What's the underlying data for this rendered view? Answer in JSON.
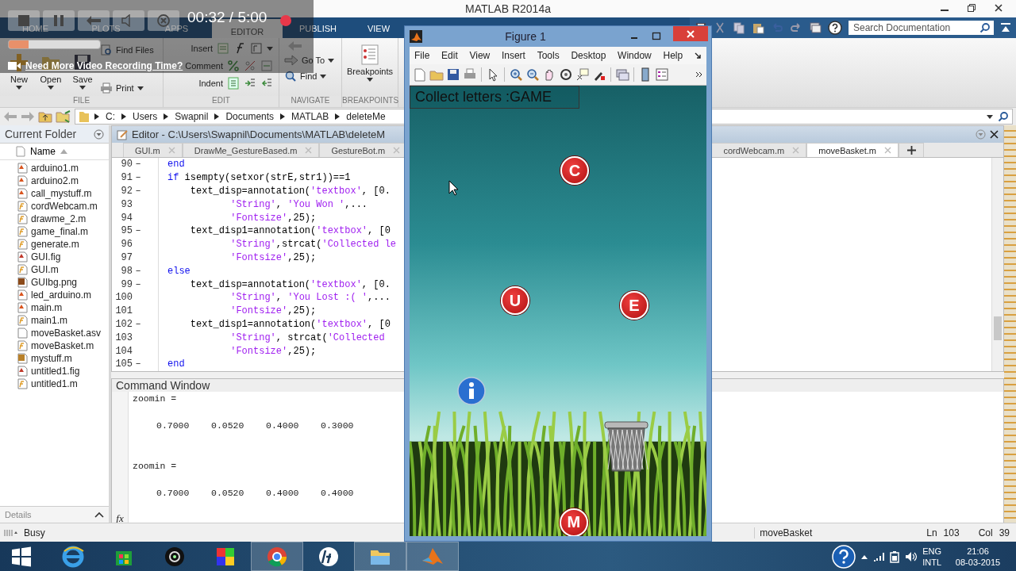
{
  "window": {
    "title": "MATLAB R2014a"
  },
  "recorder": {
    "time": "00:32 / 5:00",
    "level": 0.22,
    "link": "Need More Video Recording Time?"
  },
  "ribbon": {
    "tabs": [
      {
        "label": "HOME",
        "selected": false
      },
      {
        "label": "PLOTS",
        "selected": false
      },
      {
        "label": "APPS",
        "selected": false
      },
      {
        "label": "EDITOR",
        "selected": true
      },
      {
        "label": "PUBLISH",
        "selected": false
      },
      {
        "label": "VIEW",
        "selected": false
      }
    ],
    "file": {
      "label": "FILE",
      "new": "New",
      "open": "Open",
      "save": "Save",
      "find_files": "Find Files",
      "print": "Print"
    },
    "edit": {
      "label": "EDIT",
      "insert": "Insert",
      "comment": "Comment",
      "indent": "Indent"
    },
    "navigate": {
      "label": "NAVIGATE",
      "go_to": "Go To",
      "find": "Find"
    },
    "breakpoints": {
      "label": "BREAKPOINTS",
      "button": "Breakpoints"
    }
  },
  "search": {
    "placeholder": "Search Documentation"
  },
  "address_bar": {
    "path": [
      "C:",
      "Users",
      "Swapnil",
      "Documents",
      "MATLAB",
      "deleteMe"
    ]
  },
  "current_folder": {
    "title": "Current Folder",
    "column": "Name",
    "details": "Details",
    "files": [
      {
        "name": "arduino1.m",
        "kind": "script"
      },
      {
        "name": "arduino2.m",
        "kind": "script"
      },
      {
        "name": "call_mystuff.m",
        "kind": "script"
      },
      {
        "name": "cordWebcam.m",
        "kind": "function"
      },
      {
        "name": "drawme_2.m",
        "kind": "function"
      },
      {
        "name": "game_final.m",
        "kind": "function"
      },
      {
        "name": "generate.m",
        "kind": "function"
      },
      {
        "name": "GUI.fig",
        "kind": "figure"
      },
      {
        "name": "GUI.m",
        "kind": "function"
      },
      {
        "name": "GUIbg.png",
        "kind": "image"
      },
      {
        "name": "led_arduino.m",
        "kind": "script"
      },
      {
        "name": "main.m",
        "kind": "script"
      },
      {
        "name": "main1.m",
        "kind": "function"
      },
      {
        "name": "moveBasket.asv",
        "kind": "blank"
      },
      {
        "name": "moveBasket.m",
        "kind": "function"
      },
      {
        "name": "mystuff.m",
        "kind": "class"
      },
      {
        "name": "untitled1.fig",
        "kind": "figure"
      },
      {
        "name": "untitled1.m",
        "kind": "function"
      }
    ]
  },
  "editor": {
    "title": "Editor - C:\\Users\\Swapnil\\Documents\\MATLAB\\deleteM",
    "tabs": [
      {
        "label": "GUI.m",
        "selected": false
      },
      {
        "label": "DrawMe_GestureBased.m",
        "selected": false
      },
      {
        "label": "GestureBot.m",
        "selected": false
      }
    ],
    "more_tabs": [
      {
        "label": "cordWebcam.m",
        "selected": false
      },
      {
        "label": "moveBasket.m",
        "selected": true
      }
    ],
    "lines": [
      {
        "number": "90",
        "marker": "–",
        "code": [
          {
            "kind": "keyword",
            "text": "end"
          }
        ]
      },
      {
        "number": "91",
        "marker": "–",
        "code": [
          {
            "kind": "keyword",
            "text": "if"
          },
          {
            "kind": "plain",
            "text": " isempty(setxor(strE,str1))==1"
          }
        ]
      },
      {
        "number": "92",
        "marker": "–",
        "code": [
          {
            "kind": "plain",
            "text": "    text_disp=annotation("
          },
          {
            "kind": "string",
            "text": "'textbox'"
          },
          {
            "kind": "plain",
            "text": ", [0."
          }
        ]
      },
      {
        "number": "93",
        "code": [
          {
            "kind": "string",
            "text": "           'String'"
          },
          {
            "kind": "plain",
            "text": ", "
          },
          {
            "kind": "string",
            "text": "'You Won '"
          },
          {
            "kind": "plain",
            "text": ",..."
          }
        ]
      },
      {
        "number": "94",
        "code": [
          {
            "kind": "string",
            "text": "           'Fontsize'"
          },
          {
            "kind": "plain",
            "text": ",25);"
          }
        ]
      },
      {
        "number": "95",
        "marker": "–",
        "code": [
          {
            "kind": "plain",
            "text": "    text_disp1=annotation("
          },
          {
            "kind": "string",
            "text": "'textbox'"
          },
          {
            "kind": "plain",
            "text": ", [0"
          }
        ]
      },
      {
        "number": "96",
        "code": [
          {
            "kind": "string",
            "text": "           'String'"
          },
          {
            "kind": "plain",
            "text": ",strcat("
          },
          {
            "kind": "string",
            "text": "'Collected le"
          }
        ]
      },
      {
        "number": "97",
        "code": [
          {
            "kind": "string",
            "text": "           'Fontsize'"
          },
          {
            "kind": "plain",
            "text": ",25);"
          }
        ]
      },
      {
        "number": "98",
        "marker": "–",
        "code": [
          {
            "kind": "keyword",
            "text": "else"
          }
        ]
      },
      {
        "number": "99",
        "marker": "–",
        "code": [
          {
            "kind": "plain",
            "text": "    text_disp=annotation("
          },
          {
            "kind": "string",
            "text": "'textbox'"
          },
          {
            "kind": "plain",
            "text": ", [0."
          }
        ]
      },
      {
        "number": "100",
        "code": [
          {
            "kind": "string",
            "text": "           'String'"
          },
          {
            "kind": "plain",
            "text": ", "
          },
          {
            "kind": "string",
            "text": "'You Lost :( '"
          },
          {
            "kind": "plain",
            "text": ",..."
          }
        ]
      },
      {
        "number": "101",
        "code": [
          {
            "kind": "string",
            "text": "           'Fontsize'"
          },
          {
            "kind": "plain",
            "text": ",25);"
          }
        ]
      },
      {
        "number": "102",
        "marker": "–",
        "code": [
          {
            "kind": "plain",
            "text": "    text_disp1=annotation("
          },
          {
            "kind": "string",
            "text": "'textbox'"
          },
          {
            "kind": "plain",
            "text": ", [0"
          }
        ]
      },
      {
        "number": "103",
        "code": [
          {
            "kind": "string",
            "text": "           'String'"
          },
          {
            "kind": "plain",
            "text": ", strcat("
          },
          {
            "kind": "string",
            "text": "'Collected"
          }
        ]
      },
      {
        "number": "104",
        "code": [
          {
            "kind": "string",
            "text": "           'Fontsize'"
          },
          {
            "kind": "plain",
            "text": ",25);"
          }
        ]
      },
      {
        "number": "105",
        "marker": "–",
        "code": [
          {
            "kind": "keyword",
            "text": "end"
          }
        ]
      }
    ]
  },
  "command_window": {
    "title": "Command Window",
    "prompt": "fx",
    "output": [
      {
        "kind": "name",
        "text": "zoomin ="
      },
      {
        "kind": "values",
        "text": "0.7000    0.0520    0.4000    0.3000"
      },
      {
        "kind": "name",
        "text": "zoomin ="
      },
      {
        "kind": "values",
        "text": "0.7000    0.0520    0.4000    0.4000"
      }
    ]
  },
  "figure": {
    "title": "Figure 1",
    "menu": [
      "File",
      "Edit",
      "View",
      "Insert",
      "Tools",
      "Desktop",
      "Window",
      "Help"
    ],
    "textbox": "Collect letters :GAME",
    "letters": [
      {
        "letter": "C"
      },
      {
        "letter": "U"
      },
      {
        "letter": "E"
      },
      {
        "letter": "M"
      }
    ]
  },
  "status_bar": {
    "state": "Busy",
    "file": "moveBasket",
    "ln_label": "Ln",
    "ln": "103",
    "col_label": "Col",
    "col": "39"
  },
  "taskbar": {
    "apps": [
      {
        "kind": "browser",
        "running": false
      },
      {
        "kind": "store",
        "running": false
      },
      {
        "kind": "webcam",
        "running": false
      },
      {
        "kind": "puzzle",
        "running": false
      },
      {
        "kind": "chrome",
        "running": true
      },
      {
        "kind": "hp",
        "running": false
      },
      {
        "kind": "folder",
        "running": true
      },
      {
        "kind": "matlab",
        "running": true
      }
    ],
    "language": "ENG",
    "layout": "INTL",
    "time": "21:06",
    "date": "08-03-2015"
  }
}
